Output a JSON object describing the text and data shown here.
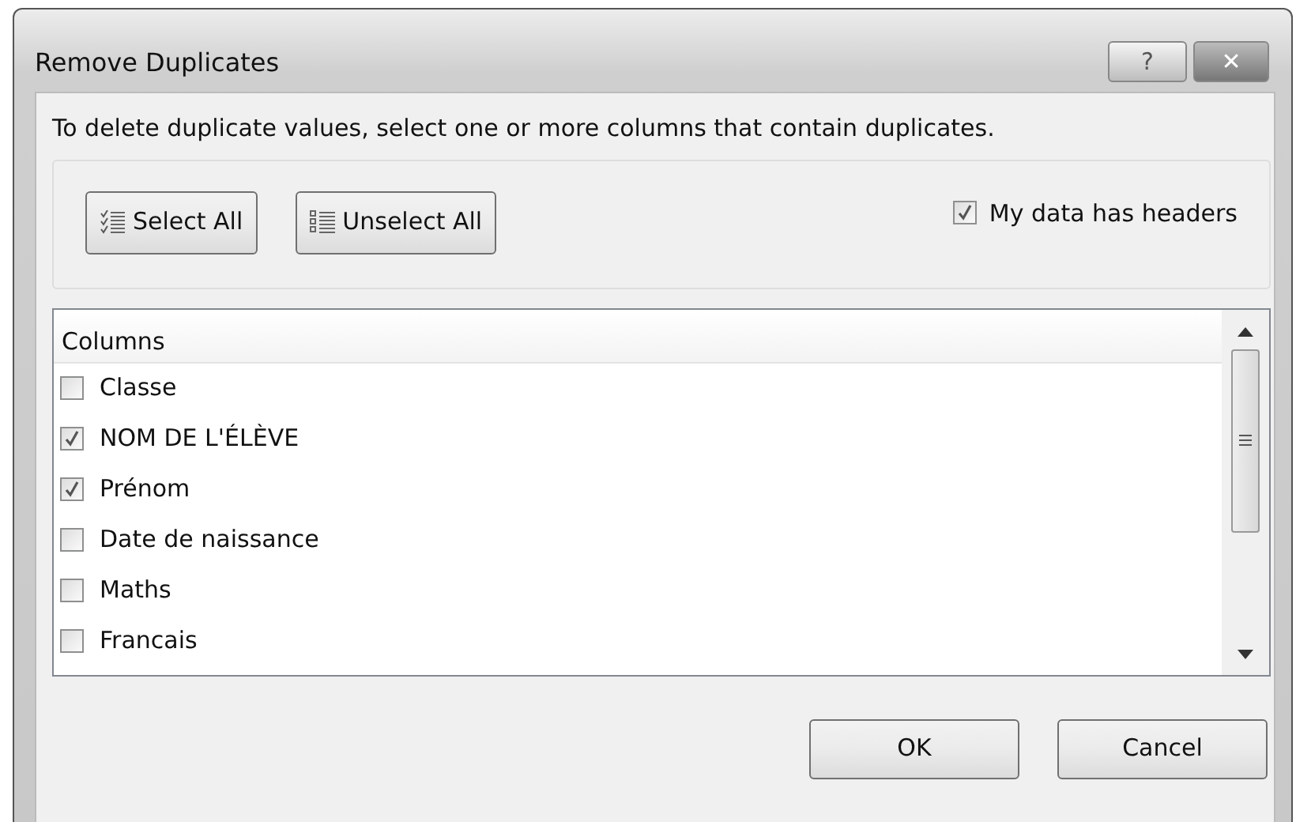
{
  "window": {
    "title": "Remove Duplicates",
    "title_buttons": [
      "?",
      "✕"
    ]
  },
  "instruction": "To delete duplicate values, select one or more columns that contain duplicates.",
  "buttons": [
    {
      "label": "Select All",
      "kind": "select"
    },
    {
      "label": "Unselect All",
      "kind": "unselect"
    }
  ],
  "headers_option": {
    "label": "My data has headers",
    "checked": true
  },
  "list": {
    "header": "Columns",
    "items": [
      {
        "label": "Classe",
        "checked": false
      },
      {
        "label": "NOM DE L'ÉLÈVE",
        "checked": true
      },
      {
        "label": "Prénom",
        "checked": true
      },
      {
        "label": "Date de naissance",
        "checked": false
      },
      {
        "label": "Maths",
        "checked": false
      },
      {
        "label": "Francais",
        "checked": false
      }
    ]
  },
  "footer_buttons": [
    "OK",
    "Cancel"
  ]
}
